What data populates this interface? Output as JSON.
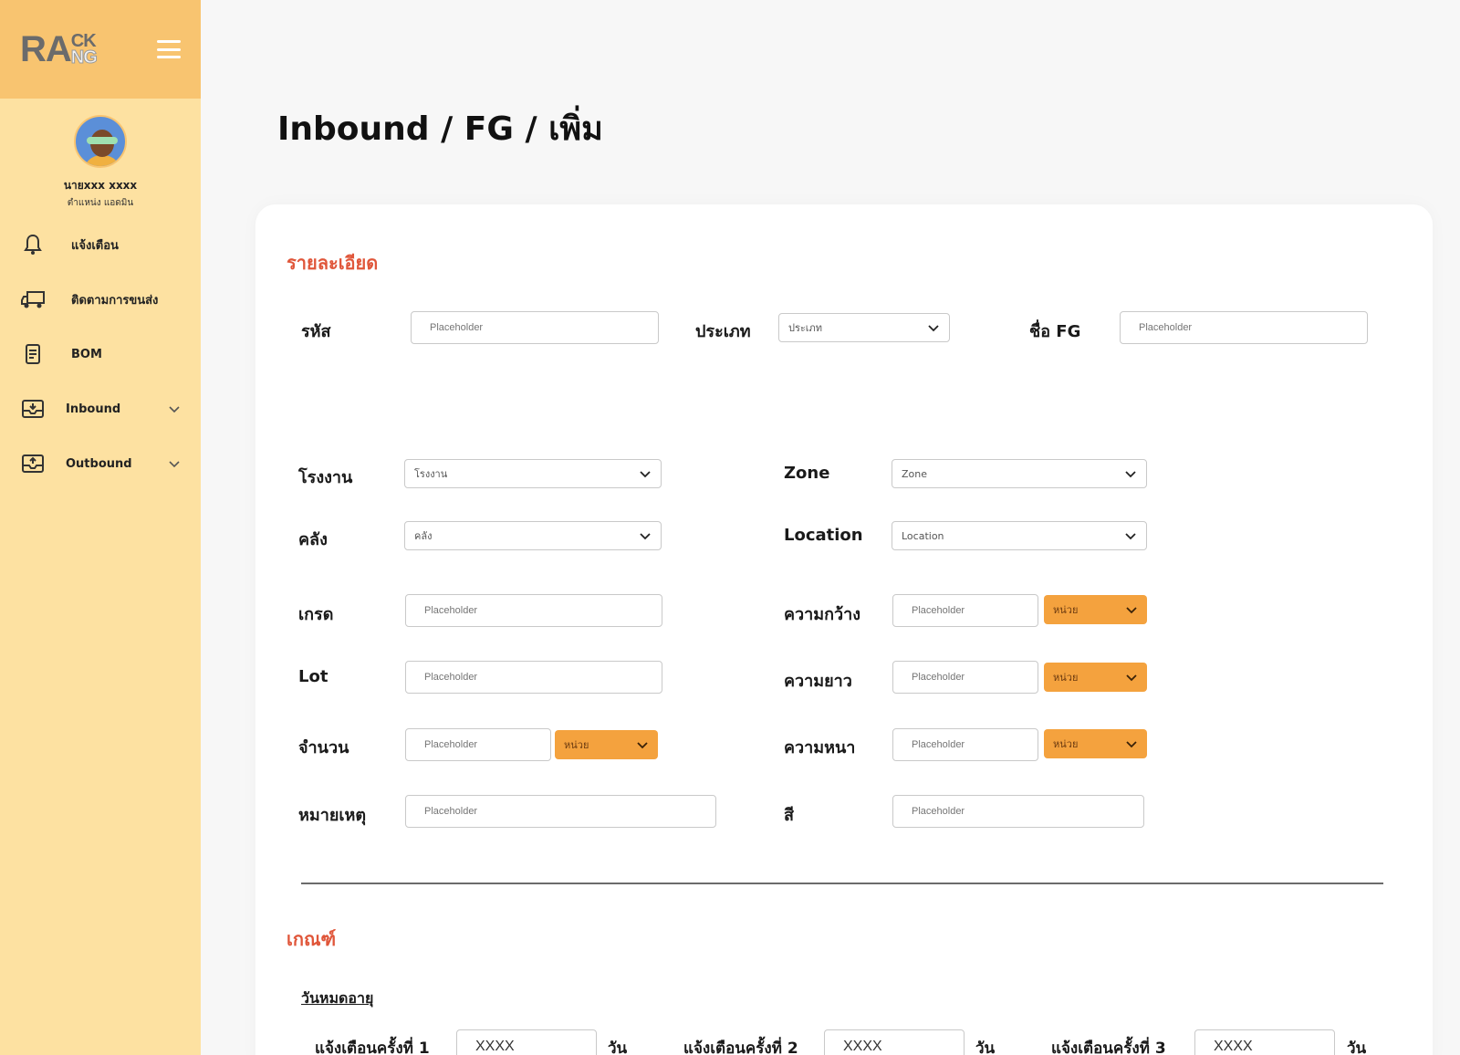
{
  "brand": {
    "letters_main": "RA",
    "letters_top": "CK",
    "letters_bottom": "NG"
  },
  "profile": {
    "name": "นายxxx xxxx",
    "role": "ตำแหน่ง แอดมิน"
  },
  "nav": [
    {
      "label": "แจ้งเตือน",
      "icon": "bell-icon"
    },
    {
      "label": "ติดตามการขนส่ง",
      "icon": "truck-icon"
    },
    {
      "label": "BOM",
      "icon": "document-list-icon"
    },
    {
      "label": "Inbound",
      "icon": "inbox-download-icon",
      "expandable": true
    },
    {
      "label": "Outbound",
      "icon": "inbox-upload-icon",
      "expandable": true
    }
  ],
  "page_title": "Inbound / FG / เพิ่ม",
  "details": {
    "title": "รายละเอียด",
    "code": {
      "label": "รหัส",
      "placeholder": "Placeholder"
    },
    "type": {
      "label": "ประเภท",
      "value": "ประเภท"
    },
    "fg_name": {
      "label": "ชื่อ FG",
      "placeholder": "Placeholder"
    },
    "factory": {
      "label": "โรงงาน",
      "value": "โรงงาน"
    },
    "zone": {
      "label": "Zone",
      "value": "Zone"
    },
    "warehouse": {
      "label": "คลัง",
      "value": "คลัง"
    },
    "location": {
      "label": "Location",
      "value": "Location"
    },
    "grade": {
      "label": "เกรด",
      "placeholder": "Placeholder"
    },
    "width": {
      "label": "ความกว้าง",
      "placeholder": "Placeholder",
      "unit": "หน่วย"
    },
    "lot": {
      "label": "Lot",
      "placeholder": "Placeholder"
    },
    "length": {
      "label": "ความยาว",
      "placeholder": "Placeholder",
      "unit": "หน่วย"
    },
    "quantity": {
      "label": "จำนวน",
      "placeholder": "Placeholder",
      "unit": "หน่วย"
    },
    "thickness": {
      "label": "ความหนา",
      "placeholder": "Placeholder",
      "unit": "หน่วย"
    },
    "note": {
      "label": "หมายเหตุ",
      "placeholder": "Placeholder"
    },
    "color": {
      "label": "สี",
      "placeholder": "Placeholder"
    }
  },
  "criteria": {
    "title": "เกณฑ์",
    "expiry_label": "วันหมดอายุ",
    "alerts": [
      {
        "label": "แจ้งเตือนครั้งที่ 1",
        "value": "XXXX",
        "suffix": "วัน"
      },
      {
        "label": "แจ้งเตือนครั้งที่ 2",
        "value": "XXXX",
        "suffix": "วัน"
      },
      {
        "label": "แจ้งเตือนครั้งที่ 3",
        "value": "XXXX",
        "suffix": "วัน"
      }
    ]
  },
  "colors": {
    "sidebar": "#fde1a1",
    "logo_bar": "#f8c470",
    "accent": "#f4a23e",
    "section_title": "#e0563a"
  }
}
